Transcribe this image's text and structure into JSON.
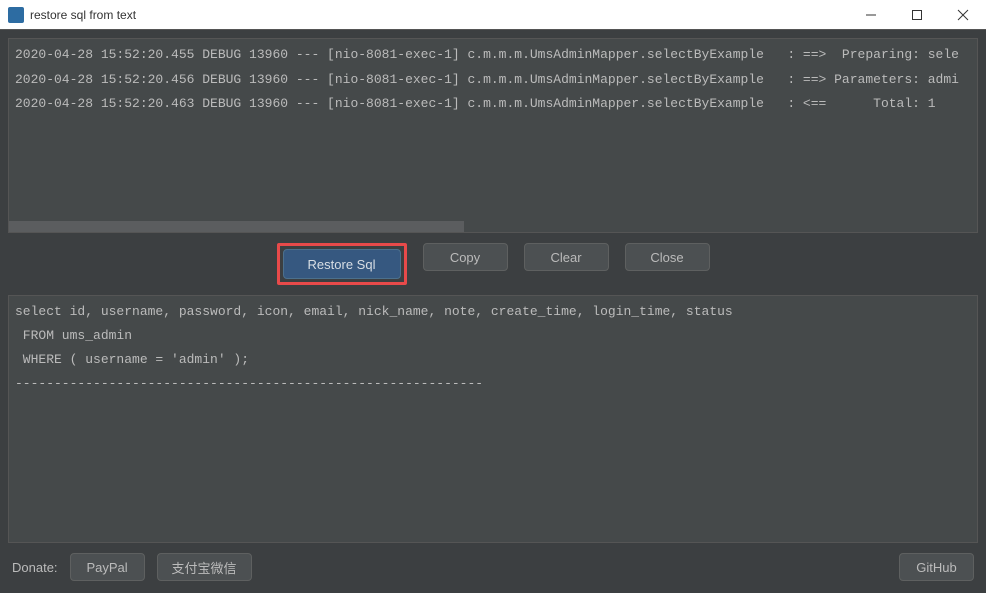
{
  "window": {
    "title": "restore sql from text"
  },
  "log": {
    "lines": [
      "2020-04-28 15:52:20.455 DEBUG 13960 --- [nio-8081-exec-1] c.m.m.m.UmsAdminMapper.selectByExample   : ==>  Preparing: sele",
      "2020-04-28 15:52:20.456 DEBUG 13960 --- [nio-8081-exec-1] c.m.m.m.UmsAdminMapper.selectByExample   : ==> Parameters: admi",
      "2020-04-28 15:52:20.463 DEBUG 13960 --- [nio-8081-exec-1] c.m.m.m.UmsAdminMapper.selectByExample   : <==      Total: 1"
    ]
  },
  "buttons": {
    "restore": "Restore Sql",
    "copy": "Copy",
    "clear": "Clear",
    "close": "Close"
  },
  "sql": {
    "text": "select id, username, password, icon, email, nick_name, note, create_time, login_time, status\n FROM ums_admin\n WHERE ( username = 'admin' );\n------------------------------------------------------------"
  },
  "footer": {
    "donate_label": "Donate:",
    "paypal": "PayPal",
    "alipay_wechat": "支付宝微信",
    "github": "GitHub"
  }
}
